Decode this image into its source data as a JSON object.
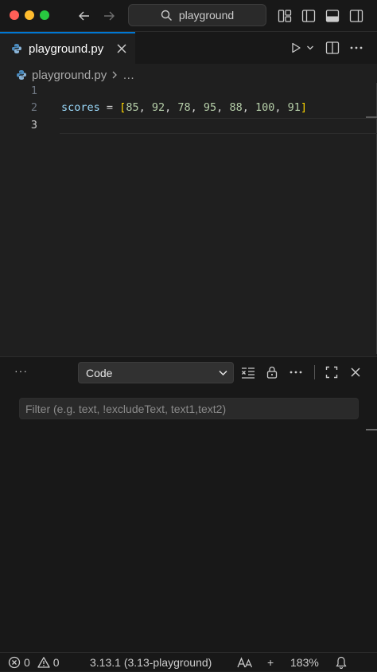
{
  "titlebar": {
    "search_text": "playground"
  },
  "tab": {
    "label": "playground.py"
  },
  "breadcrumb": {
    "file": "playground.py",
    "ellipsis": "…"
  },
  "editor": {
    "lines": [
      {
        "number": "1",
        "code": ""
      },
      {
        "number": "2",
        "code": "scores = [85, 92, 78, 95, 88, 100, 91]"
      },
      {
        "number": "3",
        "code": ""
      }
    ],
    "line2_tokens": {
      "var": "scores",
      "op": " = ",
      "bracket_open": "[",
      "n1": "85",
      "n2": "92",
      "n3": "78",
      "n4": "95",
      "n5": "88",
      "n6": "100",
      "n7": "91",
      "sep": ", ",
      "bracket_close": "]"
    }
  },
  "panel": {
    "more_label": "···",
    "dropdown_value": "Code",
    "filter_placeholder": "Filter (e.g. text, !excludeText, text1,text2)"
  },
  "statusbar": {
    "errors": "0",
    "warnings": "0",
    "interpreter": "3.13.1 (3.13-playground)",
    "plus": "+",
    "zoom": "183%"
  },
  "colors": {
    "accent": "#0078d4",
    "variable": "#9cdcfe",
    "number": "#b5cea8",
    "bracket": "#ffd700",
    "traffic_red": "#ff5f57",
    "traffic_yellow": "#febc2e",
    "traffic_green": "#28c840"
  },
  "icons": [
    "arrow-left-icon",
    "arrow-right-icon",
    "search-icon",
    "customize-layout-icon",
    "toggle-sidebar-icon",
    "toggle-panel-icon",
    "toggle-secondary-sidebar-icon",
    "python-file-icon",
    "close-icon",
    "run-icon",
    "chevron-down-icon",
    "split-editor-icon",
    "clear-output-icon",
    "lock-icon",
    "more-icon",
    "maximize-panel-icon",
    "error-icon",
    "warning-icon",
    "font-size-icon",
    "bell-icon"
  ]
}
